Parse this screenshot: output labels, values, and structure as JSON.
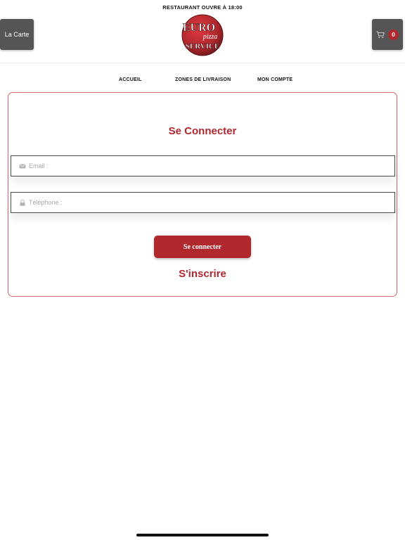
{
  "header": {
    "status_banner": "RESTAURANT OUVRE À 18:00",
    "menu_button_label": "La Carte",
    "cart_count": "0",
    "logo": {
      "line1": "EURO",
      "line2": "pizza",
      "line3": "SERVICE"
    }
  },
  "nav": {
    "items": [
      {
        "label": "ACCUEIL"
      },
      {
        "label": "ZONES DE LIVRAISON"
      },
      {
        "label": "MON COMPTE"
      }
    ]
  },
  "login": {
    "title": "Se Connecter",
    "email_placeholder": "Email :",
    "email_value": "",
    "phone_placeholder": "Téléphone :",
    "phone_value": "",
    "submit_label": "Se connecter",
    "register_label": "S'inscrire"
  },
  "icons": {
    "cart": "cart-icon",
    "email": "envelope-icon",
    "phone": "lock-icon"
  },
  "colors": {
    "brand_red": "#b0282e",
    "button_gray": "#555555",
    "card_border": "#d8676b"
  }
}
